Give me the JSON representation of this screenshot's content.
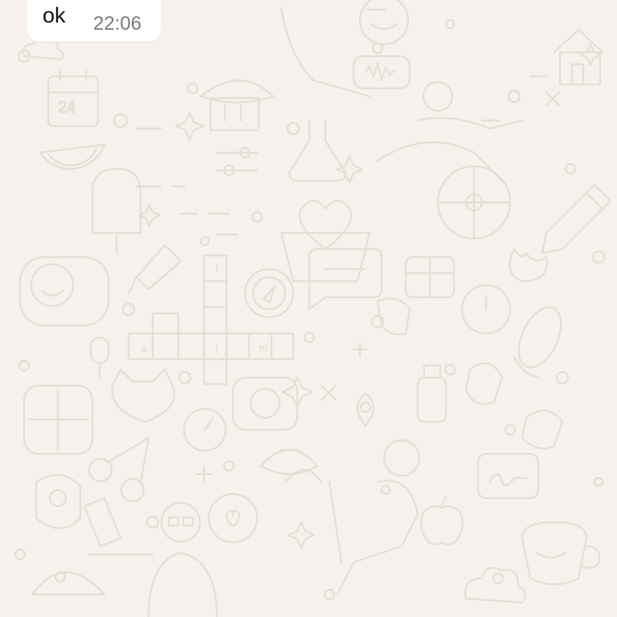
{
  "chat": {
    "messages": [
      {
        "text": "ok",
        "time": "22:06",
        "direction": "received"
      }
    ]
  },
  "wallpaper": {
    "background_color": "#f5f1ec",
    "doodle_color": "#e7ddd2",
    "crossword_letters": [
      "t",
      "a",
      "j",
      "m"
    ],
    "calendar_number": "24"
  },
  "colors": {
    "bubble": "#ffffff",
    "text": "#111111",
    "time": "#7a7a7a"
  }
}
